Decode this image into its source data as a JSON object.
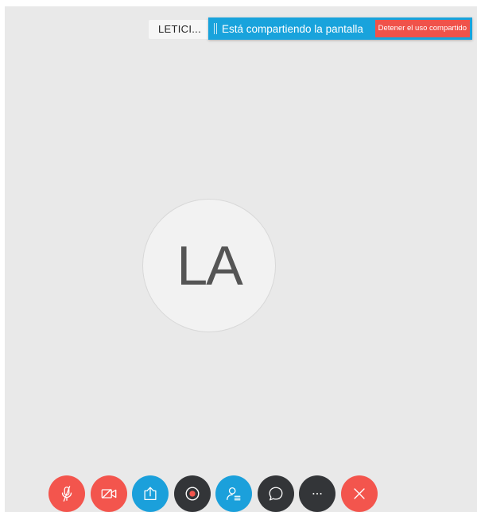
{
  "participant": {
    "chip_label": "LETICI...",
    "initials": "LA"
  },
  "share_bar": {
    "message": "Está compartiendo la pantalla",
    "stop_label": "Detener el uso compartido"
  },
  "controls": [
    {
      "name": "mute-button",
      "icon": "microphone-muted-icon",
      "color": "#f3554d"
    },
    {
      "name": "video-off-button",
      "icon": "camera-off-icon",
      "color": "#f3554d"
    },
    {
      "name": "share-button",
      "icon": "share-upload-icon",
      "color": "#1ba0db"
    },
    {
      "name": "record-button",
      "icon": "record-icon",
      "color": "#333538"
    },
    {
      "name": "participants-button",
      "icon": "participants-icon",
      "color": "#1ba0db"
    },
    {
      "name": "chat-button",
      "icon": "chat-bubble-icon",
      "color": "#333538"
    },
    {
      "name": "more-options-button",
      "icon": "ellipsis-icon",
      "color": "#333538"
    },
    {
      "name": "end-call-button",
      "icon": "close-x-icon",
      "color": "#f3554d"
    }
  ]
}
